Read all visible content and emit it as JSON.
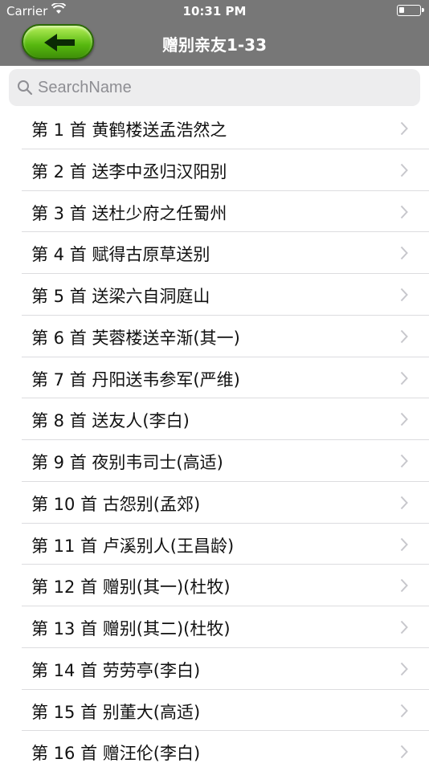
{
  "status_bar": {
    "carrier": "Carrier",
    "time": "10:31 PM",
    "battery_level": 0.25
  },
  "nav": {
    "title": "赠别亲友1-33",
    "back_icon": "green-arrow-left-icon"
  },
  "search": {
    "placeholder": "SearchName",
    "value": ""
  },
  "items": [
    {
      "label": "第 1  首  黄鹤楼送孟浩然之"
    },
    {
      "label": "第 2  首  送李中丞归汉阳别"
    },
    {
      "label": "第 3  首  送杜少府之任蜀州"
    },
    {
      "label": "第 4  首  赋得古原草送别"
    },
    {
      "label": "第 5  首  送梁六自洞庭山"
    },
    {
      "label": "第 6  首  芙蓉楼送辛渐(其一)"
    },
    {
      "label": "第 7  首  丹阳送韦参军(严维)"
    },
    {
      "label": "第 8  首  送友人(李白)"
    },
    {
      "label": "第 9  首  夜别韦司士(高适)"
    },
    {
      "label": "第 10 首  古怨别(孟郊)"
    },
    {
      "label": "第 11 首  卢溪别人(王昌龄)"
    },
    {
      "label": "第 12 首  赠别(其一)(杜牧)"
    },
    {
      "label": "第 13 首  赠别(其二)(杜牧)"
    },
    {
      "label": "第 14 首  劳劳亭(李白)"
    },
    {
      "label": "第 15 首  别董大(高适)"
    },
    {
      "label": "第 16 首  赠汪伦(李白)"
    }
  ]
}
